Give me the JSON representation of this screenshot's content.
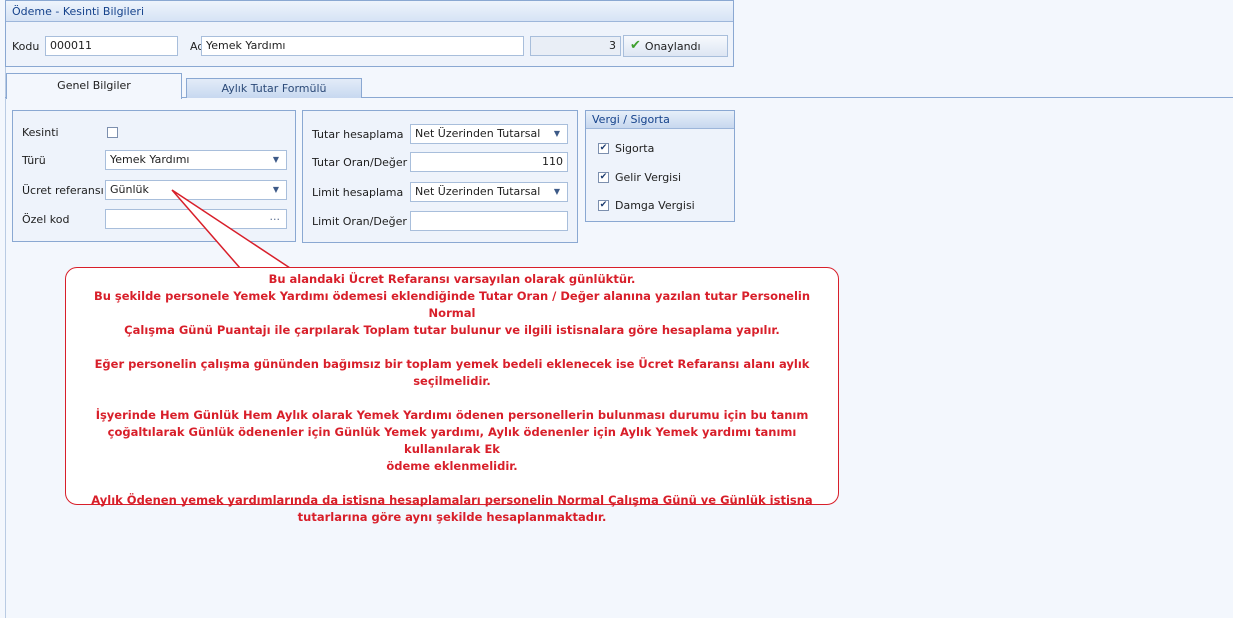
{
  "header": {
    "title": "Ödeme - Kesinti Bilgileri",
    "kodu_label": "Kodu",
    "kodu_value": "000011",
    "adi_label": "Adı",
    "adi_value": "Yemek Yardımı",
    "count_value": "3",
    "status_button_label": "Onaylandı"
  },
  "tabs": [
    {
      "label": "Genel Bilgiler",
      "active": true
    },
    {
      "label": "Aylık Tutar Formülü",
      "active": false
    }
  ],
  "left_group": {
    "kesinti_label": "Kesinti",
    "kesinti_checked": false,
    "turu_label": "Türü",
    "turu_value": "Yemek Yardımı",
    "ucret_label": "Ücret referansı",
    "ucret_value": "Günlük",
    "ozel_label": "Özel kod",
    "ozel_value": "",
    "ozel_button": "..."
  },
  "middle_group": {
    "tutar_hesap_label": "Tutar hesaplama",
    "tutar_hesap_value": "Net Üzerinden Tutarsal",
    "tutar_oran_label": "Tutar Oran/Değer",
    "tutar_oran_value": "110",
    "limit_hesap_label": "Limit hesaplama",
    "limit_hesap_value": "Net Üzerinden Tutarsal",
    "limit_oran_label": "Limit Oran/Değer",
    "limit_oran_value": ""
  },
  "vergi_group": {
    "title": "Vergi / Sigorta",
    "items": [
      {
        "label": "Sigorta",
        "checked": true
      },
      {
        "label": "Gelir Vergisi",
        "checked": true
      },
      {
        "label": "Damga Vergisi",
        "checked": true
      }
    ]
  },
  "callout": {
    "line1": "Bu alandaki Ücret Refaransı varsayılan olarak günlüktür.",
    "line2": "Bu şekilde personele  Yemek Yardımı ödemesi eklendiğinde Tutar Oran / Değer alanına yazılan tutar Personelin Normal",
    "line3": "Çalışma Günü Puantajı ile çarpılarak Toplam tutar bulunur ve ilgili istisnalara göre hesaplama yapılır.",
    "line4": "Eğer personelin çalışma gününden bağımsız bir toplam yemek bedeli eklenecek ise Ücret Refaransı alanı aylık",
    "line5": "seçilmelidir.",
    "line6": "İşyerinde Hem Günlük Hem Aylık olarak Yemek Yardımı ödenen personellerin bulunması durumu için bu tanım",
    "line7": "çoğaltılarak Günlük ödenenler için Günlük Yemek yardımı, Aylık ödenenler için Aylık Yemek yardımı tanımı kullanılarak Ek",
    "line8": "ödeme eklenmelidir.",
    "line9": "Aylık Ödenen yemek yardımlarında da istisna hesaplamaları personelin Normal Çalışma Günü ve Günlük istisna",
    "line10": "tutarlarına göre aynı şekilde hesaplanmaktadır."
  },
  "colors": {
    "accent_border": "#8aa8d2",
    "callout_red": "#d81f2a",
    "approved_green": "#3fa02f"
  }
}
